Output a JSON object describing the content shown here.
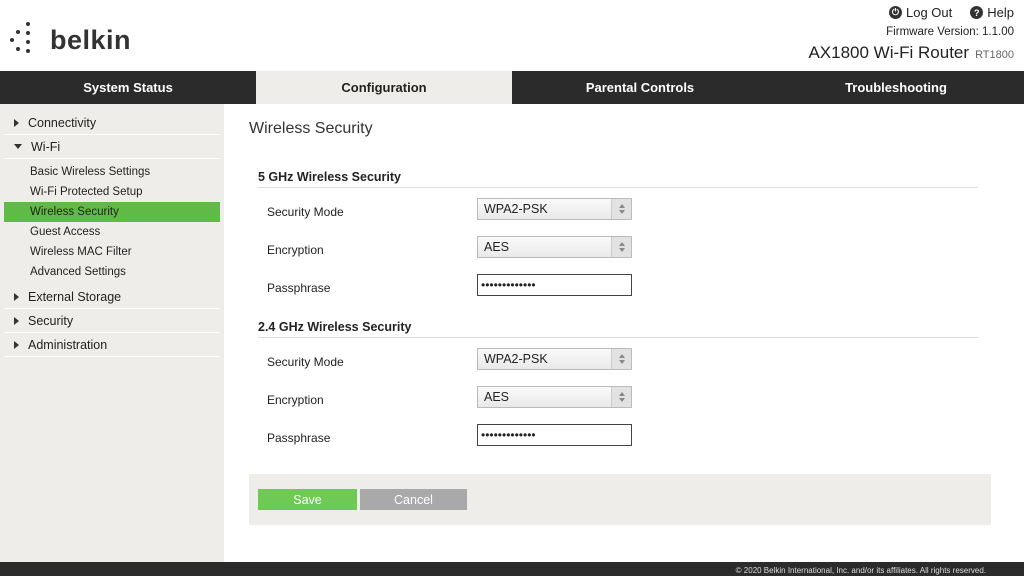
{
  "header": {
    "logo_text": "belkin",
    "logout_label": "Log Out",
    "help_label": "Help",
    "firmware": "Firmware Version: 1.1.00",
    "model": "AX1800 Wi-Fi Router",
    "model_code": "RT1800"
  },
  "nav": {
    "tabs": [
      {
        "label": "System Status"
      },
      {
        "label": "Configuration",
        "active": true
      },
      {
        "label": "Parental Controls"
      },
      {
        "label": "Troubleshooting"
      }
    ]
  },
  "sidebar": {
    "connectivity": "Connectivity",
    "wifi": "Wi-Fi",
    "wifi_items": [
      {
        "label": "Basic Wireless Settings"
      },
      {
        "label": "Wi-Fi Protected Setup"
      },
      {
        "label": "Wireless Security",
        "active": true
      },
      {
        "label": "Guest Access"
      },
      {
        "label": "Wireless MAC Filter"
      },
      {
        "label": "Advanced Settings"
      }
    ],
    "external_storage": "External Storage",
    "security": "Security",
    "administration": "Administration"
  },
  "main": {
    "title": "Wireless Security",
    "band5": {
      "title": "5 GHz Wireless Security",
      "security_mode_label": "Security Mode",
      "security_mode_value": "WPA2-PSK",
      "encryption_label": "Encryption",
      "encryption_value": "AES",
      "passphrase_label": "Passphrase",
      "passphrase_value": "•••••••••••••"
    },
    "band24": {
      "title": "2.4 GHz Wireless Security",
      "security_mode_label": "Security Mode",
      "security_mode_value": "WPA2-PSK",
      "encryption_label": "Encryption",
      "encryption_value": "AES",
      "passphrase_label": "Passphrase",
      "passphrase_value": "•••••••••••••"
    },
    "save_label": "Save",
    "cancel_label": "Cancel"
  },
  "footer": {
    "copyright": "© 2020 Belkin International, Inc. and/or its affiliates. All rights reserved."
  },
  "colors": {
    "accent_green": "#5fbb46",
    "nav_dark": "#2b2b2b",
    "panel_gray": "#efedea"
  }
}
